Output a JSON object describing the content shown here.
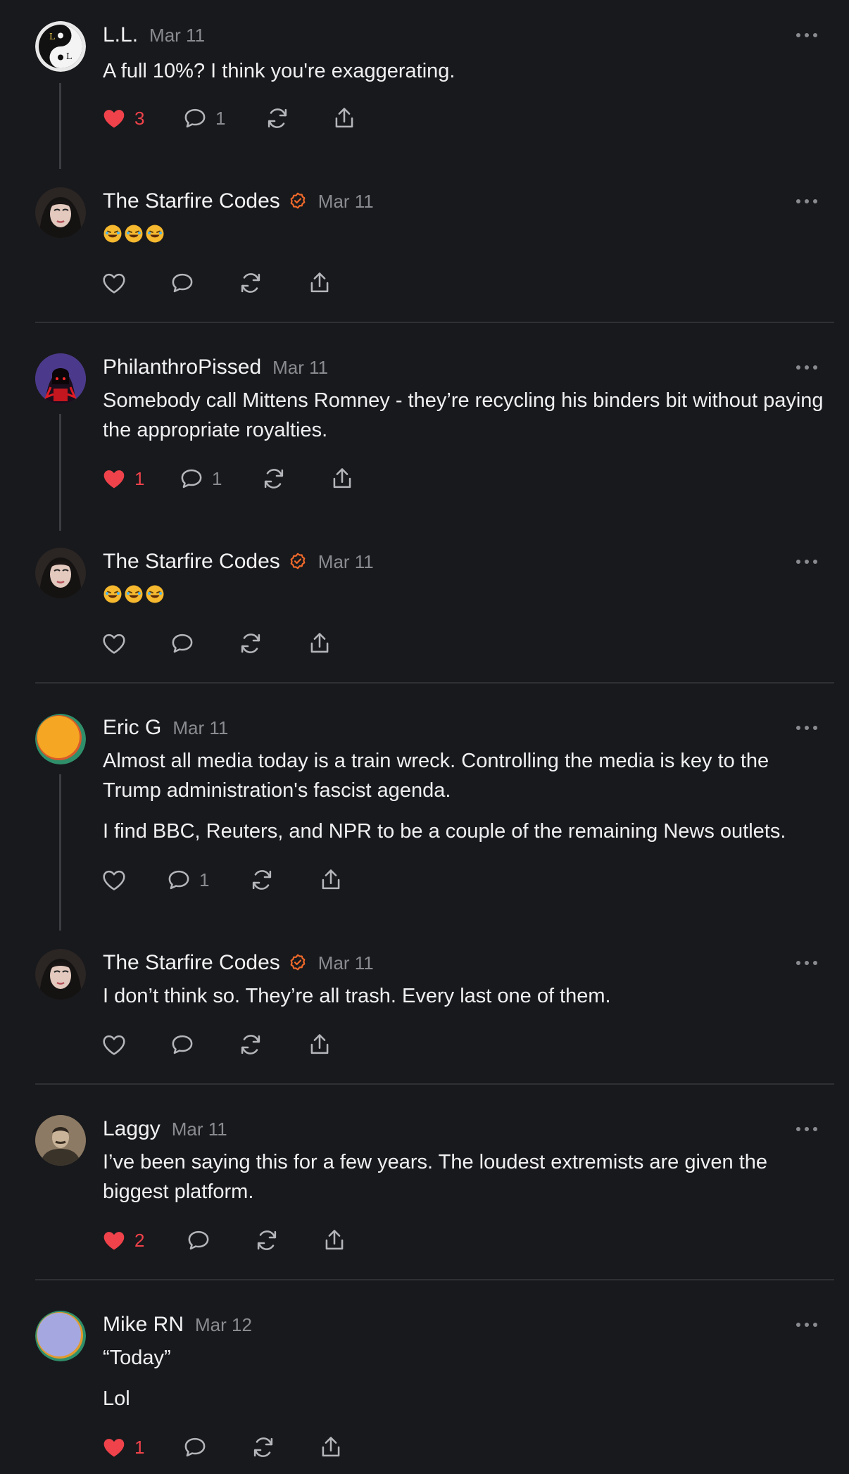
{
  "posts": [
    {
      "name": "L.L.",
      "date": "Mar 11",
      "text": [
        "A full 10%? I think you're exaggerating."
      ],
      "likes": "3",
      "liked": true,
      "replies": "1",
      "verified": false,
      "avatar": "yin-yang-avatar"
    },
    {
      "name": "The Starfire Codes",
      "date": "Mar 11",
      "text": [],
      "emoji": "🤣🤣🤣",
      "likes": "",
      "liked": false,
      "replies": "",
      "verified": true,
      "avatar": "portrait-avatar"
    },
    {
      "name": "PhilanthroPissed",
      "date": "Mar 11",
      "text": [
        "Somebody call Mittens Romney - they’re recycling his binders bit without paying the appropriate royalties."
      ],
      "likes": "1",
      "liked": true,
      "replies": "1",
      "verified": false,
      "avatar": "hooded-figure-avatar"
    },
    {
      "name": "The Starfire Codes",
      "date": "Mar 11",
      "text": [],
      "emoji": "🤣🤣🤣",
      "likes": "",
      "liked": false,
      "replies": "",
      "verified": true,
      "avatar": "portrait-avatar"
    },
    {
      "name": "Eric G",
      "date": "Mar 11",
      "text": [
        "Almost all media today is a train wreck. Controlling the media is key to the Trump administration's fascist agenda.",
        "I find BBC, Reuters, and NPR to be a couple of the remaining News outlets."
      ],
      "likes": "",
      "liked": false,
      "replies": "1",
      "verified": false,
      "avatar": "orange-default-avatar"
    },
    {
      "name": "The Starfire Codes",
      "date": "Mar 11",
      "text": [
        "I don’t think so. They’re all trash. Every last one of them."
      ],
      "likes": "",
      "liked": false,
      "replies": "",
      "verified": true,
      "avatar": "portrait-avatar"
    },
    {
      "name": "Laggy",
      "date": "Mar 11",
      "text": [
        "I’ve been saying this for a few years. The loudest extremists are given the biggest platform."
      ],
      "likes": "2",
      "liked": true,
      "replies": "",
      "verified": false,
      "avatar": "sepia-portrait-avatar"
    },
    {
      "name": "Mike RN",
      "date": "Mar 12",
      "text": [
        "“Today”",
        "Lol"
      ],
      "likes": "1",
      "liked": true,
      "replies": "",
      "verified": false,
      "avatar": "lavender-default-avatar"
    }
  ],
  "colors": {
    "background": "#18191c",
    "like": "#f0424b",
    "verified": "#f26a2b",
    "muted": "#8a8b91"
  }
}
